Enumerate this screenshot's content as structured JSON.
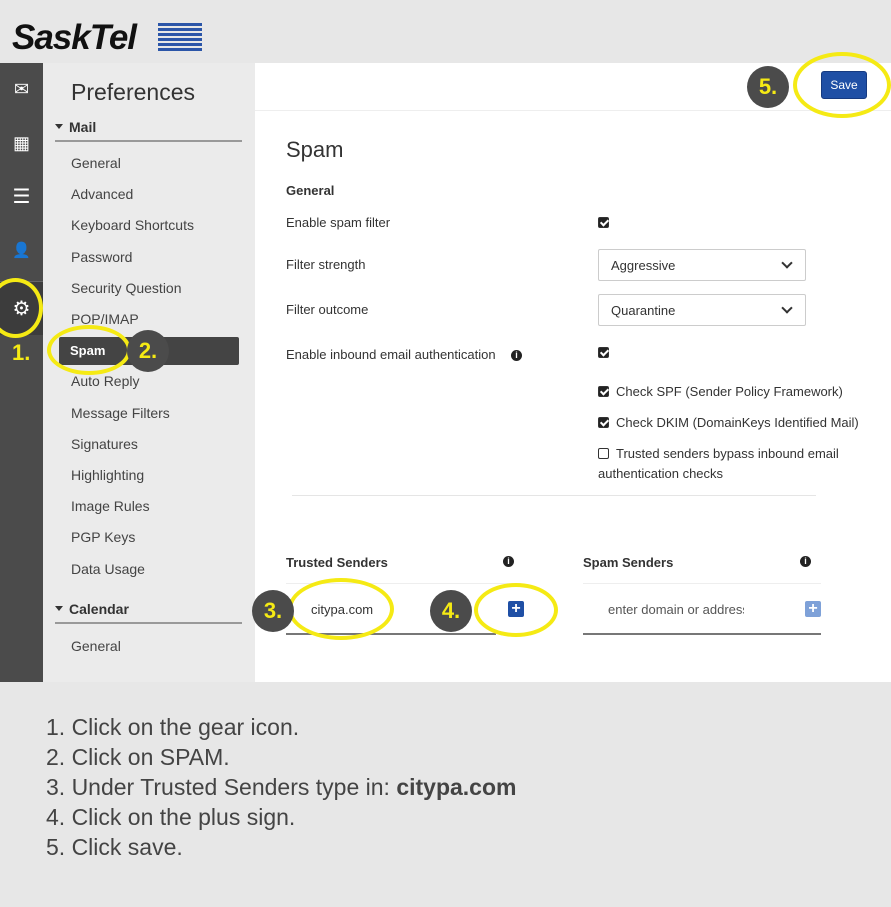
{
  "brand": {
    "name": "SaskTel"
  },
  "iconbar": [
    {
      "icon": "mail-icon",
      "g": "✉"
    },
    {
      "icon": "calendar-icon",
      "g": "▦"
    },
    {
      "icon": "list-icon",
      "g": "☰"
    },
    {
      "icon": "contacts-icon",
      "g": "👤"
    },
    {
      "icon": "gear-icon",
      "g": "⚙"
    }
  ],
  "nav": {
    "title": "Preferences",
    "mail_label": "Mail",
    "mail_items": [
      "General",
      "Advanced",
      "Keyboard Shortcuts",
      "Password",
      "Security Question",
      "POP/IMAP",
      "Spam",
      "Auto Reply",
      "Message Filters",
      "Signatures",
      "Highlighting",
      "Image Rules",
      "PGP Keys",
      "Data Usage"
    ],
    "active": "Spam",
    "calendar_label": "Calendar",
    "calendar_items": [
      "General"
    ]
  },
  "main": {
    "save_label": "Save",
    "title": "Spam",
    "general_heading": "General",
    "enable_spam_filter": {
      "label": "Enable spam filter",
      "checked": true
    },
    "filter_strength": {
      "label": "Filter strength",
      "value": "Aggressive"
    },
    "filter_outcome": {
      "label": "Filter outcome",
      "value": "Quarantine"
    },
    "inbound_auth": {
      "label": "Enable inbound email authentication",
      "checked": true
    },
    "check_spf": {
      "label": "Check SPF (Sender Policy Framework)",
      "checked": true
    },
    "check_dkim": {
      "label": "Check DKIM (DomainKeys Identified Mail)",
      "checked": true
    },
    "trusted_bypass": {
      "label1": "Trusted senders bypass inbound email",
      "label2": "authentication checks",
      "checked": false
    },
    "trusted": {
      "heading": "Trusted Senders",
      "value": "citypa.com"
    },
    "spam": {
      "heading": "Spam Senders",
      "placeholder": "enter domain or address"
    }
  },
  "annotations": [
    "1.",
    "2.",
    "3.",
    "4.",
    "5."
  ],
  "annotation_color": "#f5ea14",
  "steps": {
    "s1": "1. Click on the gear icon.",
    "s2": "2. Click on SPAM.",
    "s3_prefix": "3. Under Trusted Senders type in: ",
    "s3_bold": "citypa.com",
    "s4": "4. Click on the plus sign.",
    "s5": "5. Click save."
  }
}
